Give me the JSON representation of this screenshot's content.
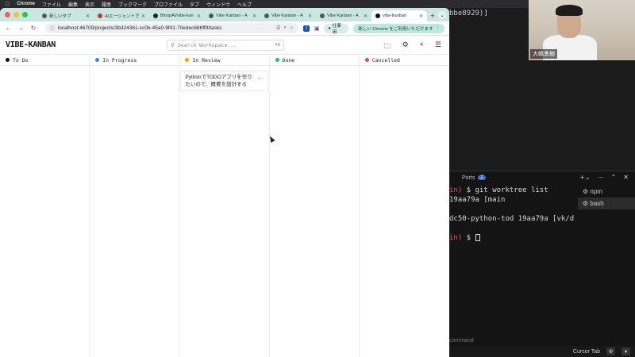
{
  "menubar": {
    "app": "Chrome",
    "items": [
      "ファイル",
      "編集",
      "表示",
      "履歴",
      "ブックマーク",
      "プロファイル",
      "タブ",
      "ウィンドウ",
      "ヘルプ"
    ]
  },
  "browser": {
    "tabs": [
      {
        "label": "新しいタブ",
        "fav_color": "#888888"
      },
      {
        "label": "AIエージェントで",
        "fav_color": "#c0392b"
      },
      {
        "label": "BloopAI/vibe-kan",
        "fav_color": "#222222"
      },
      {
        "label": "Vibe Kanban - A",
        "fav_color": "#555555"
      },
      {
        "label": "Vibe Kanban - A",
        "fav_color": "#555555"
      },
      {
        "label": "Vibe Kanban - A",
        "fav_color": "#555555"
      },
      {
        "label": "vibe-kanban",
        "fav_color": "#111111"
      }
    ],
    "url": "localhost:46709/projects/3b324361-cc0b-45a0-9f41-70edec686ff9/tasks",
    "profile_label": "仕事用",
    "update_label": "新しい Chrome をご利用いただけます",
    "ext_badge": "1"
  },
  "app": {
    "logo": "VIBE-KANBAN",
    "search_placeholder": "Search Workspace...",
    "search_shortcut": "⌘S"
  },
  "columns": [
    {
      "label": "To Do",
      "color": "#111111",
      "cards": []
    },
    {
      "label": "In Progress",
      "color": "#3b82f6",
      "cards": []
    },
    {
      "label": "In Review",
      "color": "#f59e0b",
      "cards": [
        "PythonでTODOアプリを作りたいので、概要を設計する"
      ]
    },
    {
      "label": "Done",
      "color": "#22c55e",
      "cards": []
    },
    {
      "label": "Cancelled",
      "color": "#ef4444",
      "cards": []
    }
  ],
  "webcam": {
    "name": "大嶋勇樹"
  },
  "term_top": {
    "line": "bbe8929)]"
  },
  "terminal": {
    "tab_label": "Ports",
    "tab_badge": "2",
    "lines": [
      {
        "prefix": "in)",
        "text": " $ git worktree list"
      },
      {
        "prefix": "",
        "text": "            19aa79a [main"
      },
      {
        "prefix": "",
        "text": ""
      },
      {
        "prefix": "",
        "text": "dc50-python-tod  19aa79a [vk/d"
      },
      {
        "prefix": "",
        "text": ""
      },
      {
        "prefix": "in)",
        "text": " $ "
      }
    ],
    "shells": [
      "npm",
      "bash"
    ],
    "placeholder": "command"
  },
  "statusbar": {
    "label": "Cursor Tab"
  }
}
